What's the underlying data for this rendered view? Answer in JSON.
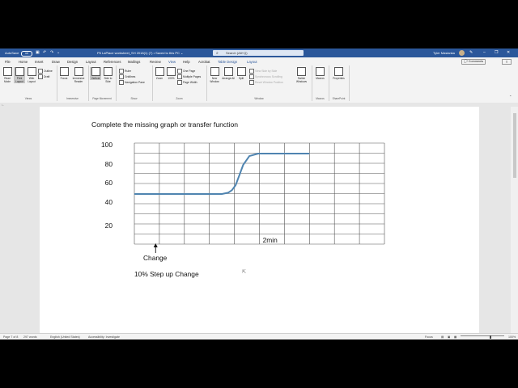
{
  "titlebar": {
    "autosave": "AutoSave",
    "autosave_state": "Off",
    "doc_title": "P5 LaPlace worksheet_SH 2018(1) (7) • Saved to this PC ⌄",
    "search_placeholder": "Search (Alt+Q)",
    "user": "Tyler Maslanka"
  },
  "menu": {
    "tabs": [
      "File",
      "Home",
      "Insert",
      "Draw",
      "Design",
      "Layout",
      "References",
      "Mailings",
      "Review",
      "View",
      "Help",
      "Acrobat",
      "Table Design",
      "Layout"
    ],
    "active_tab": "View",
    "comments_label": "Comments"
  },
  "ribbon": {
    "views": {
      "read_mode": "Read Mode",
      "print_layout": "Print Layout",
      "web_layout": "Web Layout",
      "outline": "Outline",
      "draft": "Draft",
      "label": "Views"
    },
    "immersive": {
      "focus": "Focus",
      "immersive_reader": "Immersive Reader",
      "label": "Immersive"
    },
    "page_movement": {
      "vertical": "Vertical",
      "side_to_side": "Side to Side",
      "label": "Page Movement"
    },
    "show": {
      "ruler": "Ruler",
      "gridlines": "Gridlines",
      "navigation_pane": "Navigation Pane",
      "label": "Show"
    },
    "zoom": {
      "zoom": "Zoom",
      "hundred": "100%",
      "one_page": "One Page",
      "multiple_pages": "Multiple Pages",
      "page_width": "Page Width",
      "label": "Zoom"
    },
    "window": {
      "new_window": "New Window",
      "arrange_all": "Arrange All",
      "split": "Split",
      "view_side_by_side": "View Side by Side",
      "sync_scrolling": "Synchronous Scrolling",
      "reset_position": "Reset Window Position",
      "switch_windows": "Switch Windows",
      "label": "Window"
    },
    "macros": {
      "macros": "Macros",
      "label": "Macros"
    },
    "sharepoint": {
      "properties": "Properties",
      "label": "SharePoint"
    }
  },
  "status": {
    "page": "Page 7 of 8",
    "words": "297 words",
    "language": "English (United States)",
    "accessibility": "Accessibility: Investigate",
    "focus": "Focus",
    "zoom": "100%"
  },
  "document": {
    "heading": "Complete the missing graph or transfer function",
    "change_label": "Change",
    "step_text": "10% Step up Change",
    "time_label": "2min"
  },
  "chart_data": {
    "type": "line",
    "yticks": [
      "100",
      "80",
      "60",
      "40",
      "20"
    ],
    "x_columns": 10,
    "y_rows": 10,
    "series": [
      {
        "points": [
          [
            0,
            48
          ],
          [
            3.5,
            48
          ],
          [
            3.75,
            49
          ],
          [
            3.9,
            51
          ],
          [
            4.05,
            55
          ],
          [
            4.2,
            63
          ],
          [
            4.35,
            71
          ],
          [
            4.6,
            78
          ],
          [
            4.95,
            80
          ],
          [
            7,
            80
          ]
        ]
      }
    ],
    "step_marker_x": 0.85,
    "time_label_x": 4,
    "line_color": "#4f84b0",
    "grid_color": "#555555"
  }
}
